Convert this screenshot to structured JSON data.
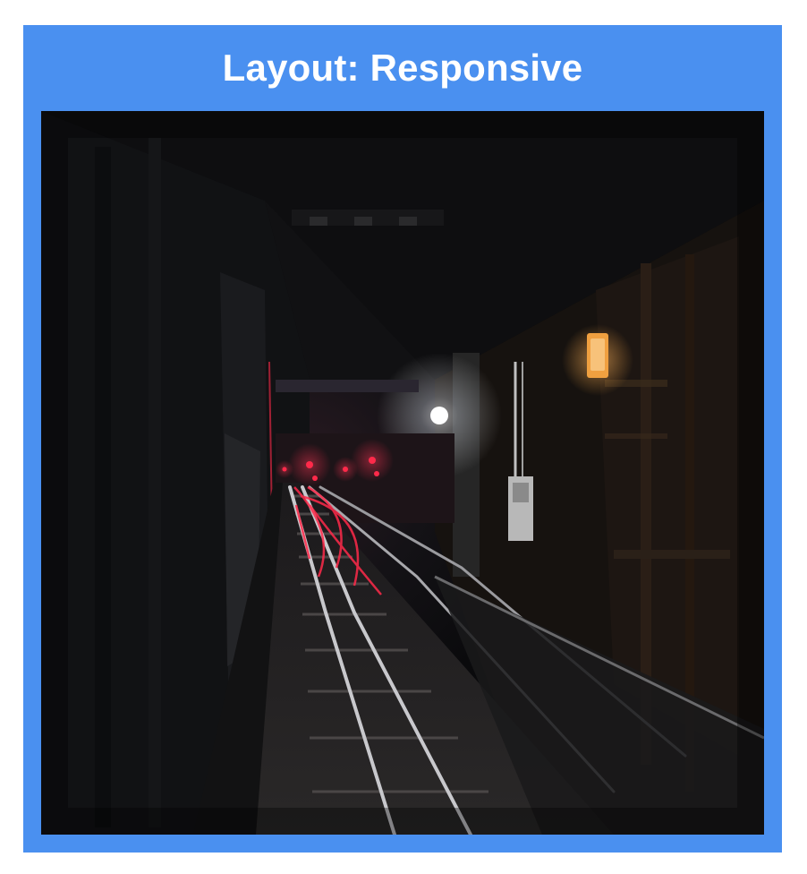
{
  "header": {
    "title": "Layout: Responsive"
  },
  "photo": {
    "subject": "subway-tunnel-tracks",
    "colors": {
      "frame": "#4a90f0",
      "background": "#0c0c0e",
      "signal_red": "#ff2a4a",
      "lamp_orange": "#f0a040",
      "light_white": "#ffffff"
    }
  }
}
